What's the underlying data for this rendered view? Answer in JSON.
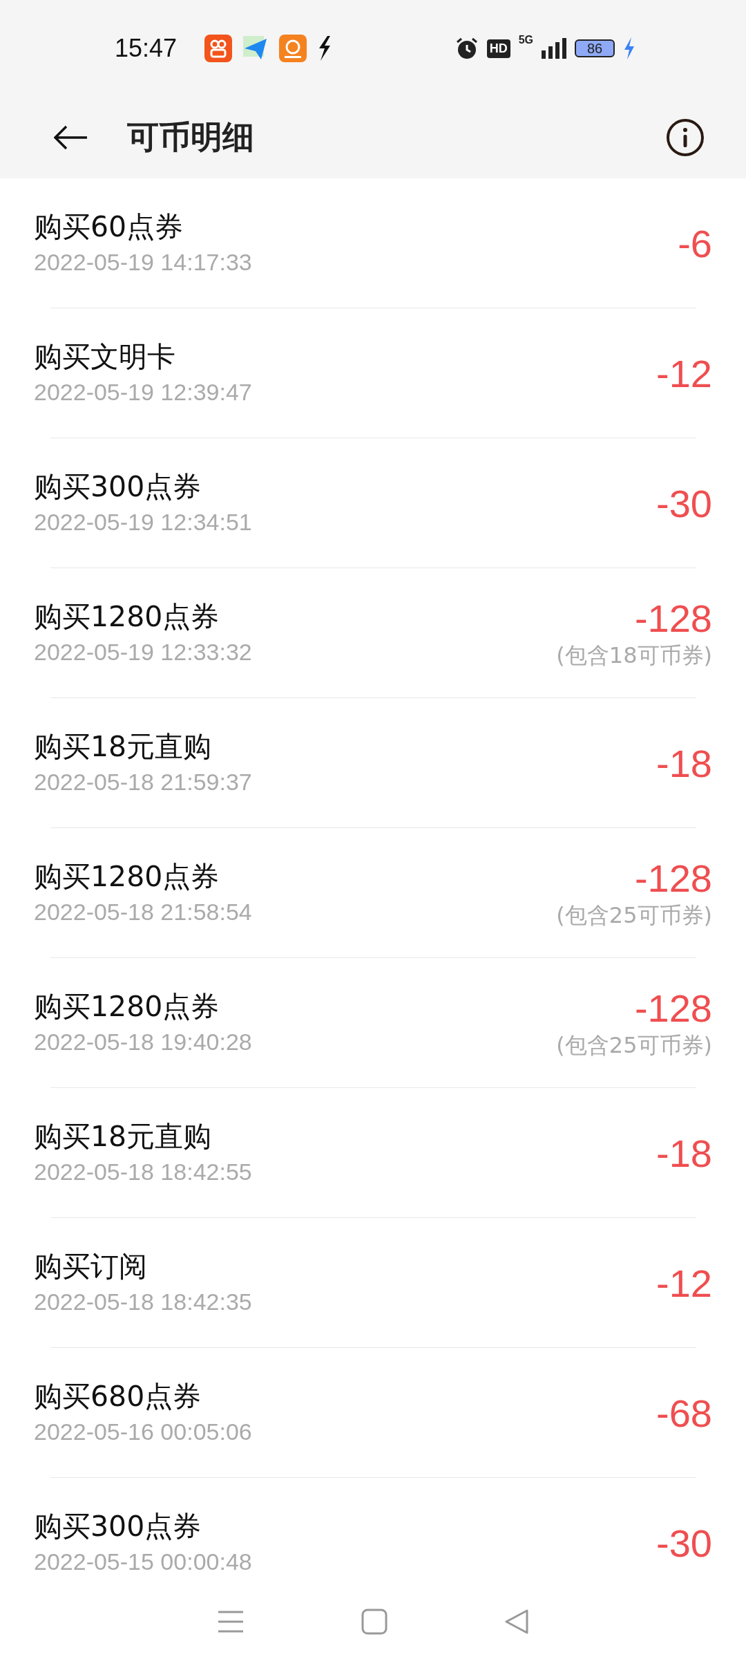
{
  "status_bar": {
    "time": "15:47",
    "hd": "HD",
    "network": "5G",
    "battery": "86"
  },
  "header": {
    "title": "可币明细"
  },
  "records": [
    {
      "title": "购买60点券",
      "time": "2022-05-19 14:17:33",
      "amount": "-6"
    },
    {
      "title": "购买文明卡",
      "time": "2022-05-19 12:39:47",
      "amount": "-12"
    },
    {
      "title": "购买300点券",
      "time": "2022-05-19 12:34:51",
      "amount": "-30"
    },
    {
      "title": "购买1280点券",
      "time": "2022-05-19 12:33:32",
      "amount": "-128",
      "note": "(包含18可币券)"
    },
    {
      "title": "购买18元直购",
      "time": "2022-05-18 21:59:37",
      "amount": "-18"
    },
    {
      "title": "购买1280点券",
      "time": "2022-05-18 21:58:54",
      "amount": "-128",
      "note": "(包含25可币券)"
    },
    {
      "title": "购买1280点券",
      "time": "2022-05-18 19:40:28",
      "amount": "-128",
      "note": "(包含25可币券)"
    },
    {
      "title": "购买18元直购",
      "time": "2022-05-18 18:42:55",
      "amount": "-18"
    },
    {
      "title": "购买订阅",
      "time": "2022-05-18 18:42:35",
      "amount": "-12"
    },
    {
      "title": "购买680点券",
      "time": "2022-05-16 00:05:06",
      "amount": "-68"
    },
    {
      "title": "购买300点券",
      "time": "2022-05-15 00:00:48",
      "amount": "-30"
    }
  ]
}
